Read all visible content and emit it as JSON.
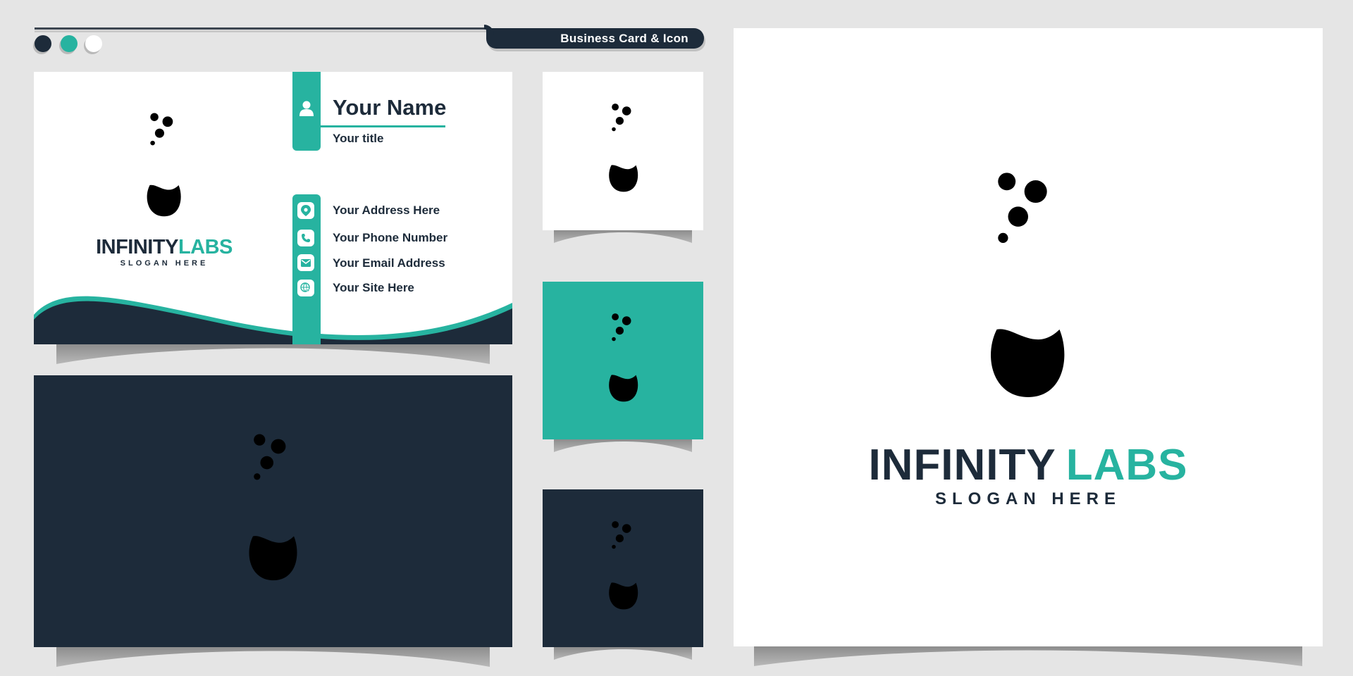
{
  "header": {
    "title": "Business Card & Icon",
    "swatches": [
      {
        "name": "navy",
        "color": "#1d2b3a"
      },
      {
        "name": "teal",
        "color": "#27b3a0"
      },
      {
        "name": "white",
        "color": "#ffffff"
      }
    ]
  },
  "brand": {
    "name_part1": "INFINITY",
    "name_part2": "LABS",
    "slogan": "SLOGAN HERE",
    "colors": {
      "primary": "#1d2b3a",
      "accent": "#27b3a0",
      "background": "#e5e5e5"
    }
  },
  "business_card": {
    "name": "Your Name",
    "title": "Your title",
    "contacts": [
      {
        "icon": "location-pin-icon",
        "label": "Your Address Here"
      },
      {
        "icon": "phone-icon",
        "label": "Your Phone Number"
      },
      {
        "icon": "envelope-icon",
        "label": "Your Email Address"
      },
      {
        "icon": "globe-cursor-icon",
        "label": "Your Site Here"
      }
    ]
  },
  "logo_variants": [
    {
      "name": "white-background-navy-logo"
    },
    {
      "name": "teal-background-white-logo"
    },
    {
      "name": "navy-background-white-teal-logo"
    }
  ]
}
